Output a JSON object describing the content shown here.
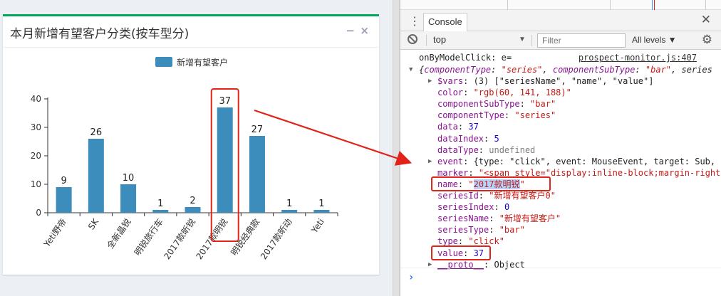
{
  "widget": {
    "title": "本月新增有望客户分类(按车型分)",
    "tools": {
      "minimize": "−",
      "close": "×"
    }
  },
  "chart_data": {
    "type": "bar",
    "title": "",
    "legend": {
      "entries": [
        "新增有望客户"
      ],
      "placement": "top-center"
    },
    "xlabel": "",
    "ylabel": "",
    "ylim": [
      0,
      40
    ],
    "yticks": [
      0,
      10,
      20,
      30,
      40
    ],
    "grid": false,
    "categories": [
      "Yeti野帝",
      "SK",
      "全新晶锐",
      "明锐旅行车",
      "2017款昕锐",
      "2017款明锐",
      "明锐经典款",
      "2017款昕动",
      "Yeti"
    ],
    "series": [
      {
        "name": "新增有望客户",
        "values": [
          9,
          26,
          10,
          1,
          2,
          37,
          27,
          1,
          1
        ],
        "color": "#3c8dbc"
      }
    ],
    "highlighted_category": "2017款明锐",
    "annotation_color": "#e2231a"
  },
  "devtools": {
    "tab": "Console",
    "context": "top",
    "filter_placeholder": "Filter",
    "levels": "All levels ▼",
    "log": {
      "head": "onByModelClick: e=",
      "source": "prospect-monitor.js:407",
      "object_summary": {
        "prefix": "{",
        "k1": "componentType",
        "v1": "\"series\"",
        "sep": ", ",
        "k2": "componentSubType",
        "v2": "\"bar\"",
        "tail": ", series"
      },
      "properties": [
        {
          "key": "$vars",
          "value": "(3) [\"seriesName\", \"name\", \"value\"]",
          "vtype": "plain",
          "expandable": true
        },
        {
          "key": "color",
          "value": "\"rgb(60, 141, 188)\"",
          "vtype": "str",
          "expandable": false
        },
        {
          "key": "componentSubType",
          "value": "\"bar\"",
          "vtype": "str",
          "expandable": false
        },
        {
          "key": "componentType",
          "value": "\"series\"",
          "vtype": "str",
          "expandable": false
        },
        {
          "key": "data",
          "value": "37",
          "vtype": "num",
          "expandable": false
        },
        {
          "key": "dataIndex",
          "value": "5",
          "vtype": "num",
          "expandable": false
        },
        {
          "key": "dataType",
          "value": "undefined",
          "vtype": "undef",
          "expandable": false
        },
        {
          "key": "event",
          "value": "{type: \"click\", event: MouseEvent, target: Sub,",
          "vtype": "plain",
          "expandable": true
        },
        {
          "key": "marker",
          "value": "\"<span style=\"display:inline-block;margin-right",
          "vtype": "str",
          "expandable": false
        },
        {
          "key": "name",
          "value": "\"2017款明锐\"",
          "vtype": "str",
          "expandable": false,
          "selected": true
        },
        {
          "key": "seriesId",
          "value": "\"新增有望客户0\"",
          "vtype": "str",
          "expandable": false
        },
        {
          "key": "seriesIndex",
          "value": "0",
          "vtype": "num",
          "expandable": false
        },
        {
          "key": "seriesName",
          "value": "\"新增有望客户\"",
          "vtype": "str",
          "expandable": false
        },
        {
          "key": "seriesType",
          "value": "\"bar\"",
          "vtype": "str",
          "expandable": false
        },
        {
          "key": "type",
          "value": "\"click\"",
          "vtype": "str",
          "expandable": false
        },
        {
          "key": "value",
          "value": "37",
          "vtype": "num",
          "expandable": false
        },
        {
          "key": "__proto__",
          "value": "Object",
          "vtype": "plain",
          "expandable": true,
          "proto": true
        }
      ]
    },
    "prompt": "›"
  }
}
